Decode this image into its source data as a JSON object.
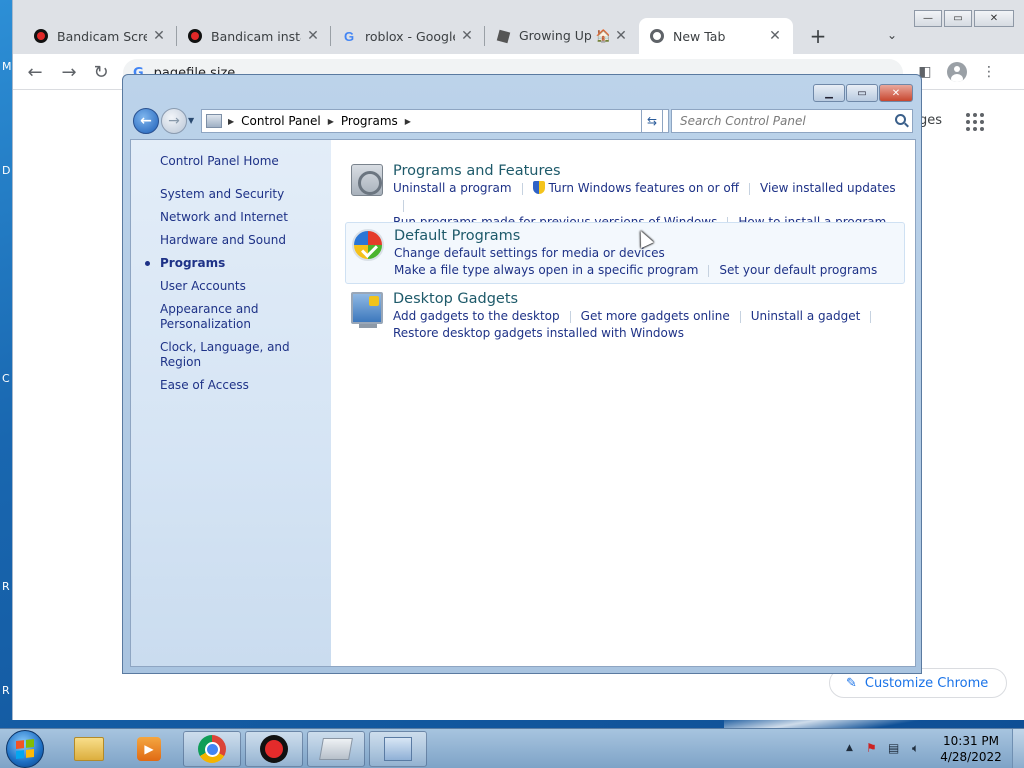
{
  "desktop": {
    "edge_labels": [
      "M",
      "D",
      "C",
      "R",
      "R"
    ]
  },
  "chrome": {
    "tabs": [
      {
        "title": "Bandicam Screen",
        "favicon": "bandicam-icon",
        "close": "✕"
      },
      {
        "title": "Bandicam installa",
        "favicon": "bandicam-icon",
        "close": "✕"
      },
      {
        "title": "roblox - Google S",
        "favicon": "google-icon",
        "close": "✕"
      },
      {
        "title": "Growing Up 🏠 Eg",
        "favicon": "roblox-icon",
        "close": "✕"
      },
      {
        "title": "New Tab",
        "favicon": "chrome-icon",
        "close": "✕"
      }
    ],
    "new_tab": "+",
    "tab_search": "⌄",
    "window_controls": {
      "minimize": "—",
      "maximize": "▭",
      "close": "✕"
    },
    "omnibox_value": "pagefile size",
    "images_link": "ges",
    "customize_label": "Customize Chrome"
  },
  "control_panel": {
    "breadcrumb": [
      "Control Panel",
      "Programs"
    ],
    "search_placeholder": "Search Control Panel",
    "sidebar": {
      "home": "Control Panel Home",
      "items": [
        {
          "label": "System and Security"
        },
        {
          "label": "Network and Internet"
        },
        {
          "label": "Hardware and Sound"
        },
        {
          "label": "Programs",
          "active": true
        },
        {
          "label": "User Accounts"
        },
        {
          "label": "Appearance and Personalization"
        },
        {
          "label": "Clock, Language, and Region"
        },
        {
          "label": "Ease of Access"
        }
      ]
    },
    "categories": [
      {
        "title": "Programs and Features",
        "icon": "programs-features-icon",
        "links": [
          "Uninstall a program",
          "Turn Windows features on or off",
          "View installed updates",
          "Run programs made for previous versions of Windows",
          "How to install a program"
        ]
      },
      {
        "title": "Default Programs",
        "icon": "default-programs-icon",
        "links": [
          "Change default settings for media or devices",
          "Make a file type always open in a specific program",
          "Set your default programs"
        ]
      },
      {
        "title": "Desktop Gadgets",
        "icon": "desktop-gadgets-icon",
        "links": [
          "Add gadgets to the desktop",
          "Get more gadgets online",
          "Uninstall a gadget",
          "Restore desktop gadgets installed with Windows"
        ]
      }
    ]
  },
  "taskbar": {
    "time": "10:31 PM",
    "date": "4/28/2022",
    "tray_expand": "▲"
  }
}
